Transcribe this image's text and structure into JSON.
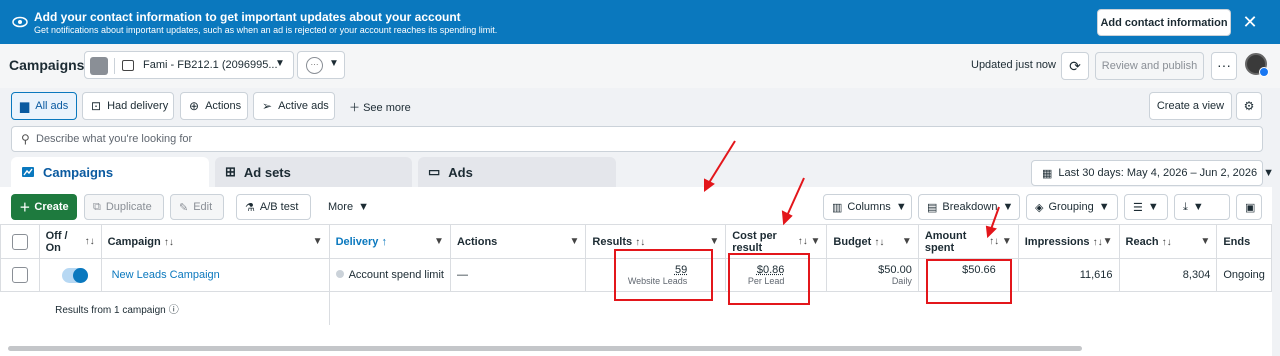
{
  "banner": {
    "title": "Add your contact information to get important updates about your account",
    "subtitle": "Get notifications about important updates, such as when an ad is rejected or your account reaches its spending limit.",
    "button": "Add contact information",
    "close": "✕"
  },
  "header": {
    "title": "Campaigns",
    "account": "Fami - FB212.1 (2096995...",
    "updated": "Updated just now",
    "review_publish": "Review and publish",
    "more": "···"
  },
  "filters": {
    "items": [
      {
        "label": "All ads",
        "icon": "folder-icon",
        "selected": true
      },
      {
        "label": "Had delivery",
        "icon": "inbox-icon"
      },
      {
        "label": "Actions",
        "icon": "arrow-circle-icon"
      },
      {
        "label": "Active ads",
        "icon": "send-icon"
      }
    ],
    "see_more": "See more",
    "create_view": "Create a view"
  },
  "search": {
    "placeholder": "Describe what you're looking for"
  },
  "tabs": [
    {
      "label": "Campaigns",
      "active": true
    },
    {
      "label": "Ad sets"
    },
    {
      "label": "Ads"
    }
  ],
  "date_range": "Last 30 days: May 4, 2026 – Jun 2, 2026",
  "toolbar": {
    "create": "Create",
    "duplicate": "Duplicate",
    "edit": "Edit",
    "ab_test": "A/B test",
    "more": "More",
    "columns": "Columns",
    "breakdown": "Breakdown",
    "grouping": "Grouping"
  },
  "table": {
    "headers": {
      "offon": "Off / On",
      "campaign": "Campaign",
      "delivery": "Delivery",
      "actions": "Actions",
      "results": "Results",
      "cpr": "Cost per result",
      "budget": "Budget",
      "amount": "Amount spent",
      "impressions": "Impressions",
      "reach": "Reach",
      "ends": "Ends"
    },
    "row": {
      "campaign": "New Leads Campaign",
      "delivery": "Account spend limit",
      "actions": "—",
      "results": "59",
      "results_sub": "Website Leads",
      "cpr": "$0.86",
      "cpr_sub": "Per Lead",
      "budget": "$50.00",
      "budget_sub": "Daily",
      "amount": "$50.66",
      "impressions": "11,616",
      "reach": "8,304",
      "ends": "Ongoing"
    },
    "summary": "Results from 1 campaign"
  },
  "colors": {
    "banner": "#0a78be",
    "create": "#1e7a3e",
    "highlight": "#e3161b",
    "link": "#0a78be"
  }
}
